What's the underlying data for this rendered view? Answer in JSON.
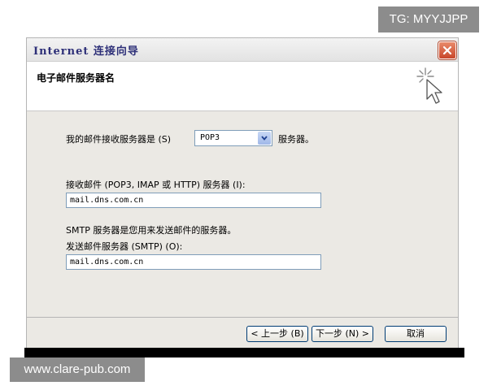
{
  "watermark_top": "TG: MYYJJPP",
  "watermark_bottom": "www.clare-pub.com",
  "window": {
    "title": "Internet 连接向导",
    "header_title": "电子邮件服务器名"
  },
  "form": {
    "incoming_server_label": "我的邮件接收服务器是 (S)",
    "incoming_server_type": "POP3",
    "incoming_server_suffix": "服务器。",
    "incoming_mail_label": "接收邮件 (POP3, IMAP 或 HTTP) 服务器 (I):",
    "incoming_mail_value": "mail.dns.com.cn",
    "smtp_info": "SMTP 服务器是您用来发送邮件的服务器。",
    "outgoing_mail_label": "发送邮件服务器 (SMTP) (O):",
    "outgoing_mail_value": "mail.dns.com.cn"
  },
  "buttons": {
    "back": "< 上一步 (B)",
    "next": "下一步 (N) >",
    "cancel": "取消"
  }
}
